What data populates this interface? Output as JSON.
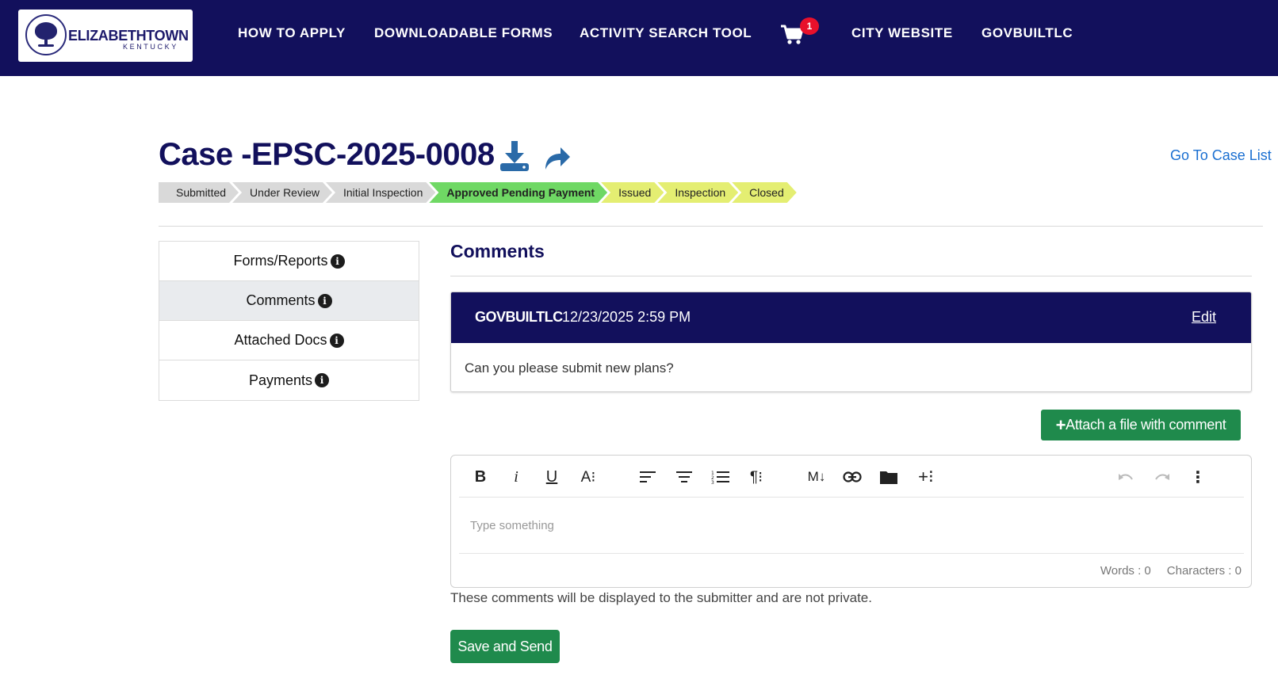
{
  "header": {
    "logo_name": "ELIZABETHTOWN",
    "logo_sub": "KENTUCKY",
    "nav": [
      {
        "label": "HOW TO APPLY"
      },
      {
        "label": "DOWNLOADABLE FORMS"
      },
      {
        "label": "ACTIVITY SEARCH TOOL"
      },
      {
        "label": "CITY WEBSITE"
      },
      {
        "label": "GOVBUILTLC"
      }
    ],
    "cart_count": "1",
    "cart_icon": "shopping-cart-icon"
  },
  "case": {
    "title": "Case -EPSC-2025-0008",
    "download_icon": "download-icon",
    "share_icon": "share-icon",
    "go_to_list": "Go To Case List"
  },
  "status_steps": [
    {
      "label": "Submitted",
      "state": "done"
    },
    {
      "label": "Under Review",
      "state": "done"
    },
    {
      "label": "Initial Inspection",
      "state": "done"
    },
    {
      "label": "Approved Pending Payment",
      "state": "current"
    },
    {
      "label": "Issued",
      "state": "todo"
    },
    {
      "label": "Inspection",
      "state": "todo"
    },
    {
      "label": "Closed",
      "state": "todo"
    }
  ],
  "sidebar": {
    "items": [
      {
        "label": "Forms/Reports",
        "active": false
      },
      {
        "label": "Comments",
        "active": true
      },
      {
        "label": "Attached Docs",
        "active": false
      },
      {
        "label": "Payments",
        "active": false
      }
    ]
  },
  "main": {
    "section_title": "Comments",
    "comment": {
      "author": "GOVBUILTLC",
      "date": "12/23/2025 2:59 PM",
      "edit_label": "Edit",
      "body": "Can you please submit new plans?"
    },
    "attach_label": "Attach a file with comment",
    "editor": {
      "placeholder": "Type something",
      "words_label": "Words : 0",
      "chars_label": "Characters : 0"
    },
    "disclaimer": "These comments will be displayed to the submitter and are not private.",
    "save_label": "Save and Send"
  },
  "colors": {
    "header_bg": "#12105c",
    "accent_green": "#1f8a4c",
    "link_blue": "#1a6fd1",
    "badge_red": "#e8102b"
  }
}
